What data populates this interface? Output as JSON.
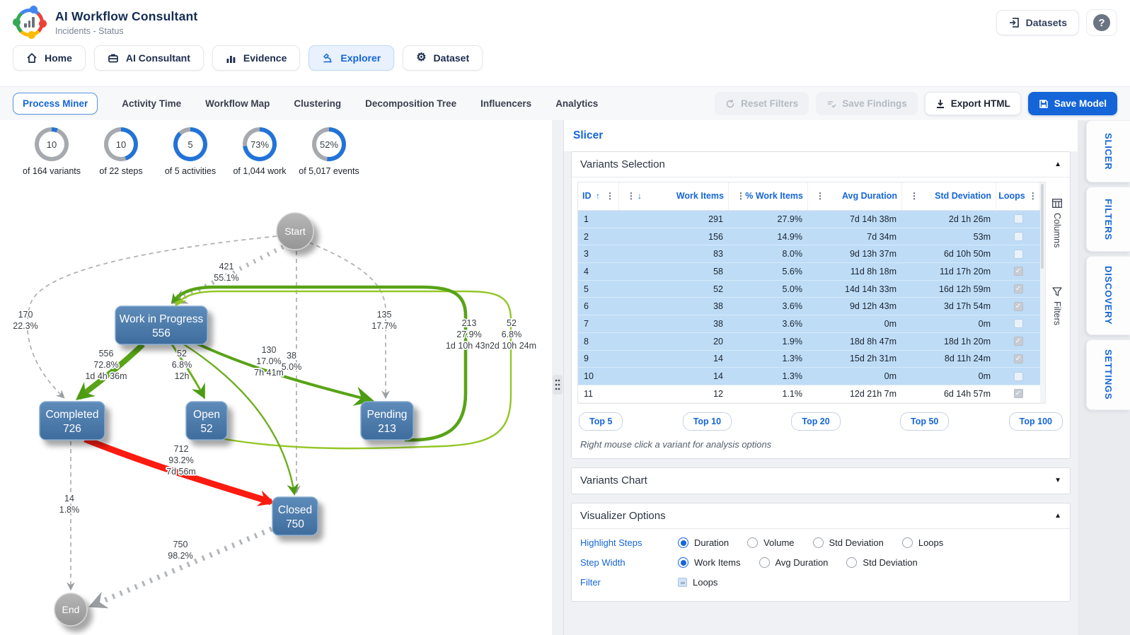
{
  "header": {
    "title": "AI Workflow Consultant",
    "subtitle": "Incidents - Status",
    "datasets_label": "Datasets",
    "help_label": "?"
  },
  "nav": {
    "items": [
      {
        "label": "Home",
        "icon": "home-icon",
        "active": false
      },
      {
        "label": "AI Consultant",
        "icon": "briefcase-icon",
        "active": false
      },
      {
        "label": "Evidence",
        "icon": "bar-chart-icon",
        "active": false
      },
      {
        "label": "Explorer",
        "icon": "microscope-icon",
        "active": true
      },
      {
        "label": "Dataset",
        "icon": "gear-icon",
        "active": false
      }
    ]
  },
  "subnav": {
    "tabs": [
      {
        "label": "Process Miner",
        "active": true
      },
      {
        "label": "Activity Time",
        "active": false
      },
      {
        "label": "Workflow Map",
        "active": false
      },
      {
        "label": "Clustering",
        "active": false
      },
      {
        "label": "Decomposition Tree",
        "active": false
      },
      {
        "label": "Influencers",
        "active": false
      },
      {
        "label": "Analytics",
        "active": false
      }
    ],
    "actions": [
      {
        "label": "Reset Filters",
        "icon": "reset-icon",
        "state": "disabled"
      },
      {
        "label": "Save Findings",
        "icon": "checklist-icon",
        "state": "disabled"
      },
      {
        "label": "Export HTML",
        "icon": "download-icon",
        "state": "white"
      },
      {
        "label": "Save Model",
        "icon": "save-icon",
        "state": "primary"
      }
    ]
  },
  "stats": [
    {
      "value": "10",
      "caption": "of 164 variants",
      "percent": 6
    },
    {
      "value": "10",
      "caption": "of 22 steps",
      "percent": 45
    },
    {
      "value": "5",
      "caption": "of 5 activities",
      "percent": 88
    },
    {
      "value": "73%",
      "caption": "of 1,044 work",
      "percent": 73
    },
    {
      "value": "52%",
      "caption": "of 5,017 events",
      "percent": 52
    }
  ],
  "process_map": {
    "nodes": [
      {
        "id": "start",
        "label": "Start",
        "value": ""
      },
      {
        "id": "work-in-progress",
        "label": "Work in Progress",
        "value": "556"
      },
      {
        "id": "completed",
        "label": "Completed",
        "value": "726"
      },
      {
        "id": "open",
        "label": "Open",
        "value": "52"
      },
      {
        "id": "pending",
        "label": "Pending",
        "value": "213"
      },
      {
        "id": "closed",
        "label": "Closed",
        "value": "750"
      },
      {
        "id": "end",
        "label": "End",
        "value": ""
      }
    ],
    "edges": [
      {
        "id": "start-to-work-in-progress",
        "lines": [
          "421",
          "55.1%"
        ]
      },
      {
        "id": "start-to-completed",
        "lines": [
          "170",
          "22.3%"
        ]
      },
      {
        "id": "start-to-pending",
        "lines": [
          "135",
          "17.7%"
        ]
      },
      {
        "id": "start-to-closed",
        "lines": []
      },
      {
        "id": "work-in-progress-to-completed",
        "lines": [
          "556",
          "72.8%",
          "1d 4h 36m"
        ]
      },
      {
        "id": "work-in-progress-to-open",
        "lines": [
          "52",
          "6.8%",
          "12h"
        ]
      },
      {
        "id": "work-in-progress-to-pending",
        "lines": [
          "130",
          "17.0%",
          "7h 41m"
        ]
      },
      {
        "id": "work-in-progress-to-closed",
        "lines": [
          "38",
          "5.0%"
        ]
      },
      {
        "id": "pending-loop-to-work-in-progress",
        "lines": [
          "213",
          "27.9%",
          "1d 10h 43m"
        ]
      },
      {
        "id": "open-loop-to-work-in-progress",
        "lines": [
          "52",
          "6.8%",
          "2d 10h 24m"
        ]
      },
      {
        "id": "completed-to-closed",
        "lines": [
          "712",
          "93.2%",
          "7d 56m"
        ]
      },
      {
        "id": "completed-to-end",
        "lines": [
          "14",
          "1.8%"
        ]
      },
      {
        "id": "closed-to-end",
        "lines": [
          "750",
          "98.2%"
        ]
      }
    ]
  },
  "slicer": {
    "title": "Slicer",
    "variants_selection": {
      "heading": "Variants Selection",
      "columns": [
        "ID",
        "Work Items",
        "% Work Items",
        "Avg Duration",
        "Std Deviation",
        "Loops"
      ],
      "sort": {
        "id": "asc",
        "work_items": "desc"
      },
      "rows": [
        {
          "id": "1",
          "work_items": "291",
          "pct_work_items": "27.9%",
          "avg_duration": "7d 14h 38m",
          "std_deviation": "2d 1h 26m",
          "loops": false,
          "selected": true
        },
        {
          "id": "2",
          "work_items": "156",
          "pct_work_items": "14.9%",
          "avg_duration": "7d 34m",
          "std_deviation": "53m",
          "loops": false,
          "selected": true
        },
        {
          "id": "3",
          "work_items": "83",
          "pct_work_items": "8.0%",
          "avg_duration": "9d 13h 37m",
          "std_deviation": "6d 10h 50m",
          "loops": false,
          "selected": true
        },
        {
          "id": "4",
          "work_items": "58",
          "pct_work_items": "5.6%",
          "avg_duration": "11d 8h 18m",
          "std_deviation": "11d 17h 20m",
          "loops": true,
          "selected": true
        },
        {
          "id": "5",
          "work_items": "52",
          "pct_work_items": "5.0%",
          "avg_duration": "14d 14h 33m",
          "std_deviation": "16d 12h 59m",
          "loops": true,
          "selected": true
        },
        {
          "id": "6",
          "work_items": "38",
          "pct_work_items": "3.6%",
          "avg_duration": "9d 12h 43m",
          "std_deviation": "3d 17h 54m",
          "loops": true,
          "selected": true
        },
        {
          "id": "7",
          "work_items": "38",
          "pct_work_items": "3.6%",
          "avg_duration": "0m",
          "std_deviation": "0m",
          "loops": false,
          "selected": true
        },
        {
          "id": "8",
          "work_items": "20",
          "pct_work_items": "1.9%",
          "avg_duration": "18d 8h 47m",
          "std_deviation": "18d 1h 20m",
          "loops": true,
          "selected": true
        },
        {
          "id": "9",
          "work_items": "14",
          "pct_work_items": "1.3%",
          "avg_duration": "15d 2h 31m",
          "std_deviation": "8d 11h 24m",
          "loops": true,
          "selected": true
        },
        {
          "id": "10",
          "work_items": "14",
          "pct_work_items": "1.3%",
          "avg_duration": "0m",
          "std_deviation": "0m",
          "loops": false,
          "selected": true
        },
        {
          "id": "11",
          "work_items": "12",
          "pct_work_items": "1.1%",
          "avg_duration": "12d 21h 7m",
          "std_deviation": "6d 14h 57m",
          "loops": true,
          "selected": false
        }
      ],
      "top_buttons": [
        "Top 5",
        "Top 10",
        "Top 20",
        "Top 50",
        "Top 100"
      ],
      "hint": "Right mouse click a variant for analysis options",
      "rail": {
        "columns_label": "Columns",
        "filters_label": "Filters"
      }
    },
    "variants_chart": {
      "heading": "Variants Chart"
    },
    "visualizer_options": {
      "heading": "Visualizer Options",
      "rows": [
        {
          "label": "Highlight Steps",
          "type": "radio",
          "options": [
            "Duration",
            "Volume",
            "Std Deviation",
            "Loops"
          ],
          "selected": 0
        },
        {
          "label": "Step Width",
          "type": "radio",
          "options": [
            "Work Items",
            "Avg Duration",
            "Std Deviation"
          ],
          "selected": 0
        },
        {
          "label": "Filter",
          "type": "checkbox",
          "options": [
            "Loops"
          ],
          "checkbox_state": "indeterminate"
        }
      ]
    }
  },
  "side_tabs": [
    "SLICER",
    "FILTERS",
    "DISCOVERY",
    "SETTINGS"
  ],
  "colors": {
    "accent_blue": "#1565d8",
    "donut_blue": "#2273d8",
    "donut_gray": "#a6aaaf",
    "selected_row": "#bedcf6",
    "node_blue": "#44749f",
    "edge_green": "#53a015",
    "edge_light_green": "#94c626",
    "edge_red": "#fb1b10",
    "edge_gray": "#a9acb0"
  }
}
